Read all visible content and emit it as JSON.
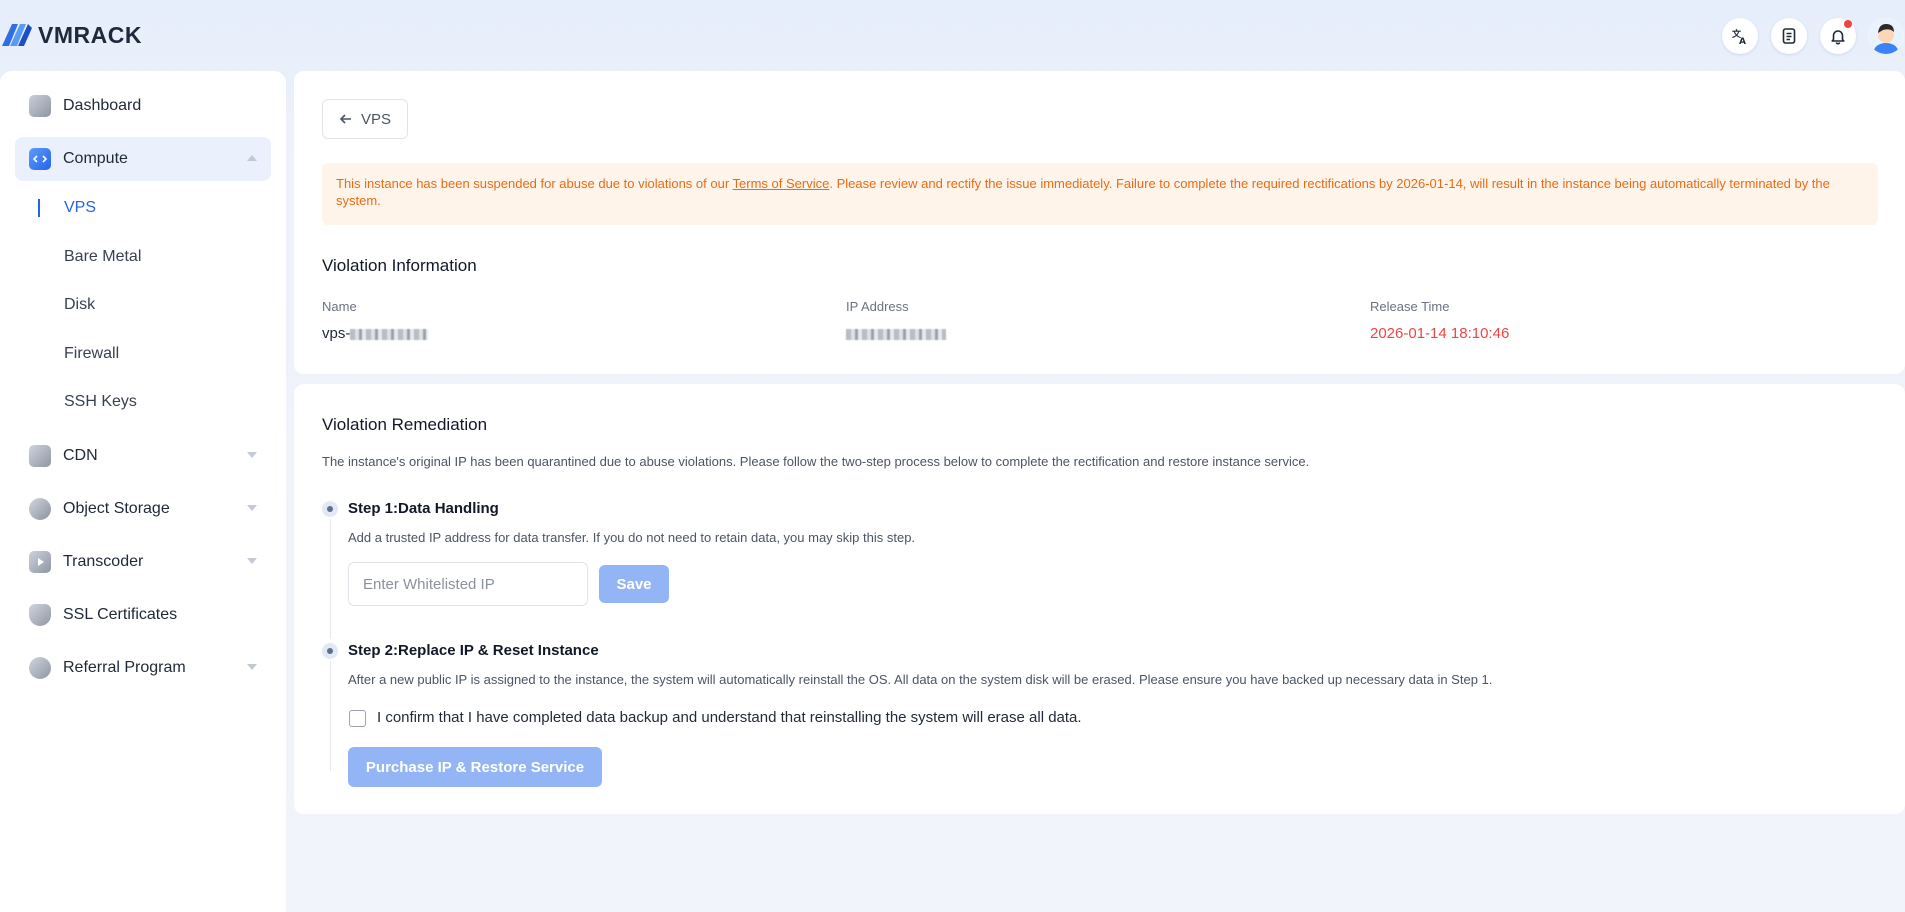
{
  "brand": {
    "name": "VMRACK"
  },
  "colors": {
    "accent": "#2563eb",
    "alert_text": "#ea6b13",
    "alert_bg": "#fff4ea",
    "danger": "#ef4444",
    "disabled_button": "#93b5f5"
  },
  "header": {
    "icons": [
      "translate-icon",
      "document-icon",
      "bell-icon",
      "user-avatar"
    ],
    "notification_unread": true
  },
  "sidebar": {
    "items": [
      {
        "label": "Dashboard",
        "icon": "dashboard-icon",
        "expandable": false
      },
      {
        "label": "Compute",
        "icon": "compute-icon",
        "expandable": true,
        "expanded": true,
        "active": true,
        "children": [
          "VPS",
          "Bare Metal",
          "Disk",
          "Firewall",
          "SSH Keys"
        ],
        "active_child": "VPS"
      },
      {
        "label": "CDN",
        "icon": "cdn-icon",
        "expandable": true
      },
      {
        "label": "Object Storage",
        "icon": "object-storage-icon",
        "expandable": true
      },
      {
        "label": "Transcoder",
        "icon": "transcoder-icon",
        "expandable": true
      },
      {
        "label": "SSL Certificates",
        "icon": "ssl-shield-icon",
        "expandable": false
      },
      {
        "label": "Referral Program",
        "icon": "referral-icon",
        "expandable": true
      }
    ]
  },
  "back_button": {
    "label": "VPS",
    "icon": "arrow-left-icon"
  },
  "alert": {
    "prefix": "This instance has been suspended for abuse due to violations of our ",
    "link": "Terms of Service",
    "suffix": ". Please review and rectify the issue immediately. Failure to complete the required rectifications by 2026-01-14, will result in the instance being automatically terminated by the system."
  },
  "violation_info": {
    "title": "Violation Information",
    "name_label": "Name",
    "name_value": "vps-",
    "ip_label": "IP Address",
    "release_label": "Release Time",
    "release_value": "2026-01-14 18:10:46"
  },
  "remediation": {
    "title": "Violation Remediation",
    "description": "The instance's original IP has been quarantined due to abuse violations. Please follow the two-step process below to complete the rectification and restore instance service.",
    "step1": {
      "title": "Step 1:Data Handling",
      "description": "Add a trusted IP address for data transfer. If you do not need to retain data, you may skip this step.",
      "input_placeholder": "Enter Whitelisted IP",
      "input_value": "",
      "save_label": "Save"
    },
    "step2": {
      "title": "Step 2:Replace IP & Reset Instance",
      "description": "After a new public IP is assigned to the instance, the system will automatically reinstall the OS. All data on the system disk will be erased. Please ensure you have backed up necessary data in Step 1.",
      "confirm_text": "I confirm that I have completed data backup and understand that reinstalling the system will erase all data.",
      "confirm_checked": false,
      "purchase_label": "Purchase IP & Restore Service"
    }
  }
}
